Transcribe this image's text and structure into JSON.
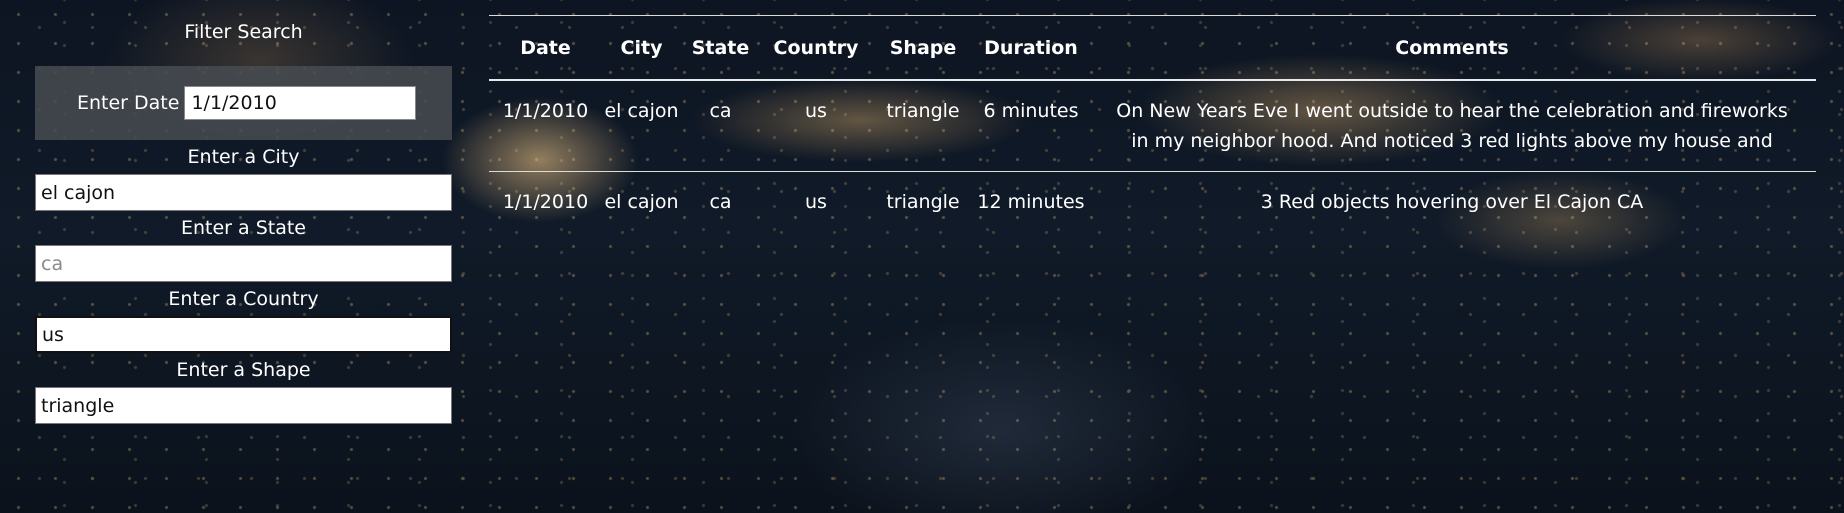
{
  "filter": {
    "title": "Filter Search",
    "date_label": "Enter Date",
    "date_value": "1/1/2010",
    "city_label": "Enter a City",
    "city_value": "el cajon",
    "state_label": "Enter a State",
    "state_placeholder": "ca",
    "state_value": "",
    "country_label": "Enter a Country",
    "country_value": "us",
    "shape_label": "Enter a Shape",
    "shape_value": "triangle"
  },
  "table": {
    "headers": [
      "Date",
      "City",
      "State",
      "Country",
      "Shape",
      "Duration",
      "Comments"
    ],
    "rows": [
      {
        "date": "1/1/2010",
        "city": "el cajon",
        "state": "ca",
        "country": "us",
        "shape": "triangle",
        "duration": "6 minutes",
        "comments": "On New Years Eve I went outside to hear the celebration and fireworks in my neighbor hood. And noticed 3 red lights above my house and"
      },
      {
        "date": "1/1/2010",
        "city": "el cajon",
        "state": "ca",
        "country": "us",
        "shape": "triangle",
        "duration": "12 minutes",
        "comments": "3 Red objects hovering over El Cajon CA"
      }
    ]
  }
}
